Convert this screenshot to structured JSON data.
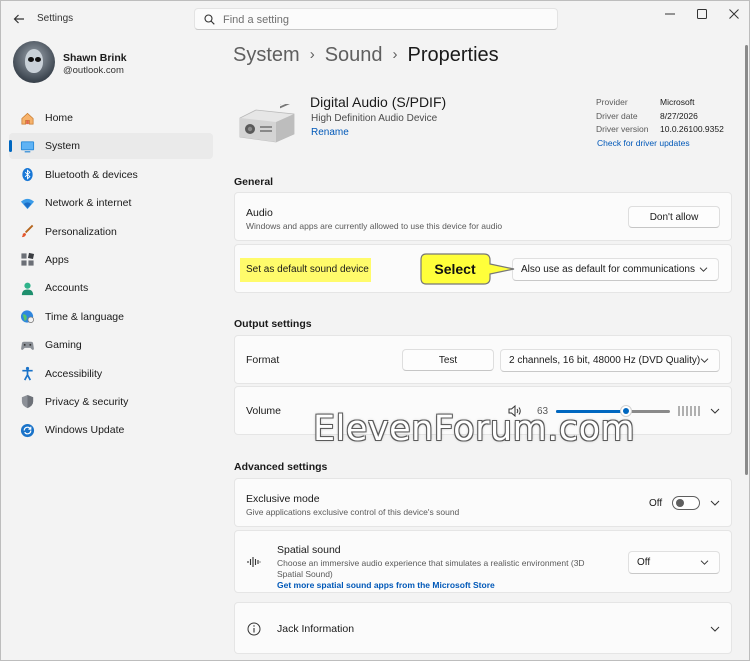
{
  "window": {
    "app_title": "Settings",
    "search_placeholder": "Find a setting"
  },
  "profile": {
    "name": "Shawn Brink",
    "email": "@outlook.com"
  },
  "sidebar": {
    "items": [
      {
        "label": "Home",
        "icon": "home-icon"
      },
      {
        "label": "System",
        "icon": "system-icon",
        "selected": true
      },
      {
        "label": "Bluetooth & devices",
        "icon": "bluetooth-icon"
      },
      {
        "label": "Network & internet",
        "icon": "network-icon"
      },
      {
        "label": "Personalization",
        "icon": "personalization-icon"
      },
      {
        "label": "Apps",
        "icon": "apps-icon"
      },
      {
        "label": "Accounts",
        "icon": "accounts-icon"
      },
      {
        "label": "Time & language",
        "icon": "time-language-icon"
      },
      {
        "label": "Gaming",
        "icon": "gaming-icon"
      },
      {
        "label": "Accessibility",
        "icon": "accessibility-icon"
      },
      {
        "label": "Privacy & security",
        "icon": "privacy-icon"
      },
      {
        "label": "Windows Update",
        "icon": "windows-update-icon"
      }
    ]
  },
  "breadcrumb": {
    "items": [
      "System",
      "Sound",
      "Properties"
    ]
  },
  "device": {
    "name": "Digital Audio (S/PDIF)",
    "subtitle": "High Definition Audio Device",
    "rename_label": "Rename"
  },
  "driver": {
    "provider_label": "Provider",
    "provider_value": "Microsoft",
    "date_label": "Driver date",
    "date_value": "8/27/2026",
    "version_label": "Driver version",
    "version_value": "10.0.26100.9352",
    "check_link": "Check for driver updates"
  },
  "general": {
    "section_title": "General",
    "audio_title": "Audio",
    "audio_desc": "Windows and apps are currently allowed to use this device for audio",
    "audio_button": "Don't allow",
    "default_label": "Set as default sound device",
    "default_dropdown": "Also use as default for communications",
    "callout_text": "Select"
  },
  "output": {
    "section_title": "Output settings",
    "format_label": "Format",
    "test_button": "Test",
    "format_value": "2 channels, 16 bit, 48000 Hz (DVD Quality)",
    "volume_label": "Volume",
    "volume_value": "63"
  },
  "watermark": "ElevenForum.com",
  "advanced": {
    "section_title": "Advanced settings",
    "exclusive_title": "Exclusive mode",
    "exclusive_desc": "Give applications exclusive control of this device's sound",
    "exclusive_state": "Off",
    "spatial_title": "Spatial sound",
    "spatial_desc_1": "Choose an immersive audio experience that simulates a realistic environment (3D",
    "spatial_desc_2": "Spatial Sound)",
    "spatial_link": "Get more spatial sound apps from the Microsoft Store",
    "spatial_value": "Off",
    "jack_title": "Jack Information"
  },
  "colors": {
    "accent": "#0067c0",
    "highlight": "#fffb6b",
    "callout": "#ffff3a"
  }
}
